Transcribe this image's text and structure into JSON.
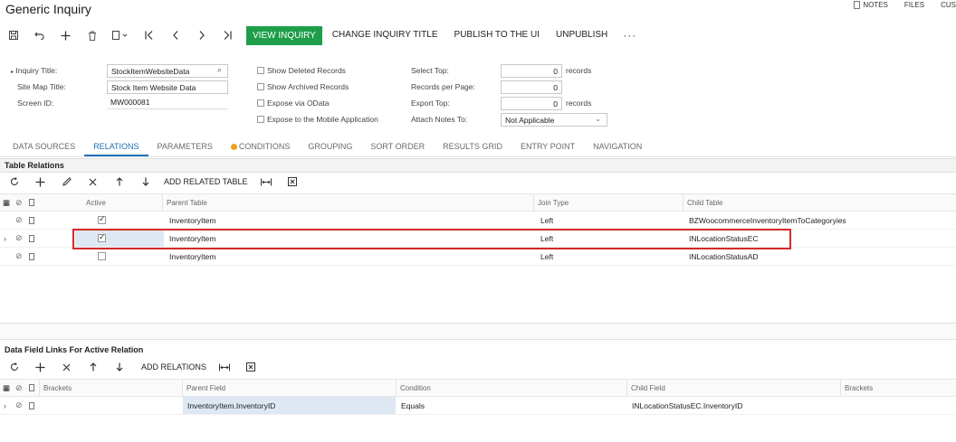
{
  "page": {
    "title": "Generic Inquiry"
  },
  "top_links": {
    "notes": "NOTES",
    "files": "FILES",
    "cus": "CUS"
  },
  "toolbar": {
    "view_inquiry": "VIEW INQUIRY",
    "change_title": "CHANGE INQUIRY TITLE",
    "publish": "PUBLISH TO THE UI",
    "unpublish": "UNPUBLISH",
    "more": "···",
    "icons": [
      "save-icon",
      "undo-icon",
      "add-icon",
      "delete-icon",
      "copy-paste-icon",
      "first-icon",
      "prev-icon",
      "next-icon",
      "last-icon"
    ]
  },
  "form": {
    "inquiry_title_label": "Inquiry Title:",
    "inquiry_title_value": "StockItemWebsiteData",
    "site_map_title_label": "Site Map Title:",
    "site_map_title_value": "Stock Item Website Data",
    "screen_id_label": "Screen ID:",
    "screen_id_value": "MW000081",
    "show_deleted": "Show Deleted Records",
    "show_archived": "Show Archived Records",
    "expose_odata": "Expose via OData",
    "expose_mobile": "Expose to the Mobile Application",
    "select_top_label": "Select Top:",
    "select_top_value": "0",
    "records_per_page_label": "Records per Page:",
    "records_per_page_value": "0",
    "export_top_label": "Export Top:",
    "export_top_value": "0",
    "records_unit": "records",
    "attach_notes_label": "Attach Notes To:",
    "attach_notes_value": "Not Applicable"
  },
  "tabs": [
    {
      "label": "DATA SOURCES"
    },
    {
      "label": "RELATIONS",
      "active": true
    },
    {
      "label": "PARAMETERS"
    },
    {
      "label": "CONDITIONS",
      "warning": true
    },
    {
      "label": "GROUPING"
    },
    {
      "label": "SORT ORDER"
    },
    {
      "label": "RESULTS GRID"
    },
    {
      "label": "ENTRY POINT"
    },
    {
      "label": "NAVIGATION"
    }
  ],
  "table_relations": {
    "header": "Table Relations",
    "add_related": "ADD RELATED TABLE",
    "columns": {
      "active": "Active",
      "parent": "Parent Table",
      "join": "Join Type",
      "child": "Child Table"
    },
    "rows": [
      {
        "active": true,
        "parent": "InventoryItem",
        "join": "Left",
        "child": "BZWoocommerceInventoryItemToCategoryies"
      },
      {
        "active": true,
        "parent": "InventoryItem",
        "join": "Left",
        "child": "INLocationStatusEC",
        "selected": true
      },
      {
        "active": false,
        "parent": "InventoryItem",
        "join": "Left",
        "child": "INLocationStatusAD"
      }
    ]
  },
  "field_links": {
    "header": "Data Field Links For Active Relation",
    "add_relations": "ADD RELATIONS",
    "columns": {
      "brackets": "Brackets",
      "parent": "Parent Field",
      "condition": "Condition",
      "child": "Child Field",
      "brackets2": "Brackets"
    },
    "rows": [
      {
        "brackets": "",
        "parent": "InventoryItem.InventoryID",
        "condition": "Equals",
        "child": "INLocationStatusEC.InventoryID",
        "brackets2": ""
      }
    ]
  },
  "colors": {
    "primary": "#1f9e4a",
    "active_tab": "#1d6fb8",
    "highlight": "#d62828",
    "selected_cell": "#dde8f3"
  }
}
